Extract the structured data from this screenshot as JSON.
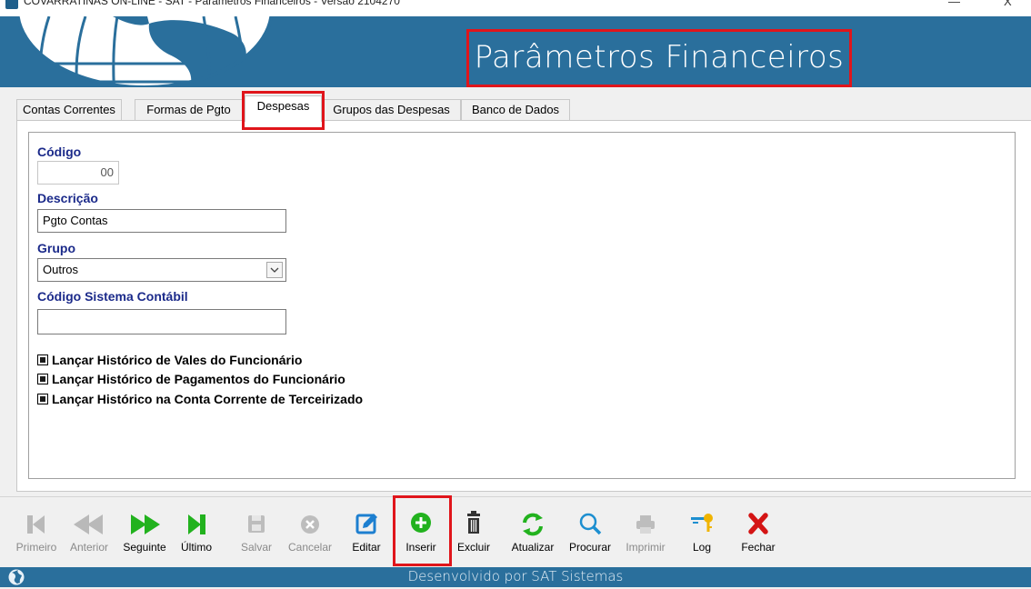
{
  "window": {
    "title": "COVARRATINAS ON-LINE - SAT - Parâmetros Financeiros - Versão 2104270",
    "minimize": "—",
    "close": "X"
  },
  "header": {
    "title": "Parâmetros Financeiros"
  },
  "tabs": [
    {
      "label": "Contas Correntes"
    },
    {
      "label": "Formas de Pgto"
    },
    {
      "label": "Despesas"
    },
    {
      "label": "Grupos das Despesas"
    },
    {
      "label": "Banco de Dados"
    }
  ],
  "active_tab": "Despesas",
  "form": {
    "codigo_label": "Código",
    "codigo_value": "00",
    "descricao_label": "Descrição",
    "descricao_value": "Pgto Contas",
    "grupo_label": "Grupo",
    "grupo_value": "Outros",
    "codigo_contabil_label": "Código Sistema Contábil",
    "codigo_contabil_value": "",
    "checks": [
      {
        "label": "Lançar Histórico de Vales do Funcionário",
        "checked": true
      },
      {
        "label": "Lançar Histórico de Pagamentos do Funcionário",
        "checked": true
      },
      {
        "label": "Lançar Histórico na Conta Corrente de Terceirizado",
        "checked": true
      }
    ]
  },
  "toolbar": {
    "buttons": [
      {
        "label": "Primeiro",
        "icon": "first-record-icon",
        "enabled": false
      },
      {
        "label": "Anterior",
        "icon": "previous-record-icon",
        "enabled": false
      },
      {
        "label": "Seguinte",
        "icon": "next-record-icon",
        "enabled": true
      },
      {
        "label": "Último",
        "icon": "last-record-icon",
        "enabled": true
      },
      {
        "label": "Salvar",
        "icon": "save-icon",
        "enabled": false
      },
      {
        "label": "Cancelar",
        "icon": "cancel-icon",
        "enabled": false
      },
      {
        "label": "Editar",
        "icon": "edit-icon",
        "enabled": true
      },
      {
        "label": "Inserir",
        "icon": "add-icon",
        "enabled": true
      },
      {
        "label": "Excluir",
        "icon": "trash-icon",
        "enabled": true
      },
      {
        "label": "Atualizar",
        "icon": "refresh-icon",
        "enabled": true
      },
      {
        "label": "Procurar",
        "icon": "search-icon",
        "enabled": true
      },
      {
        "label": "Imprimir",
        "icon": "print-icon",
        "enabled": false
      },
      {
        "label": "Log",
        "icon": "key-icon",
        "enabled": true
      },
      {
        "label": "Fechar",
        "icon": "close-icon",
        "enabled": true
      }
    ]
  },
  "status": {
    "text": "Desenvolvido por SAT Sistemas"
  },
  "colors": {
    "header_bg": "#2a6f9c",
    "highlight": "#e0151b",
    "label": "#1b2a8a",
    "green": "#22b21e"
  }
}
